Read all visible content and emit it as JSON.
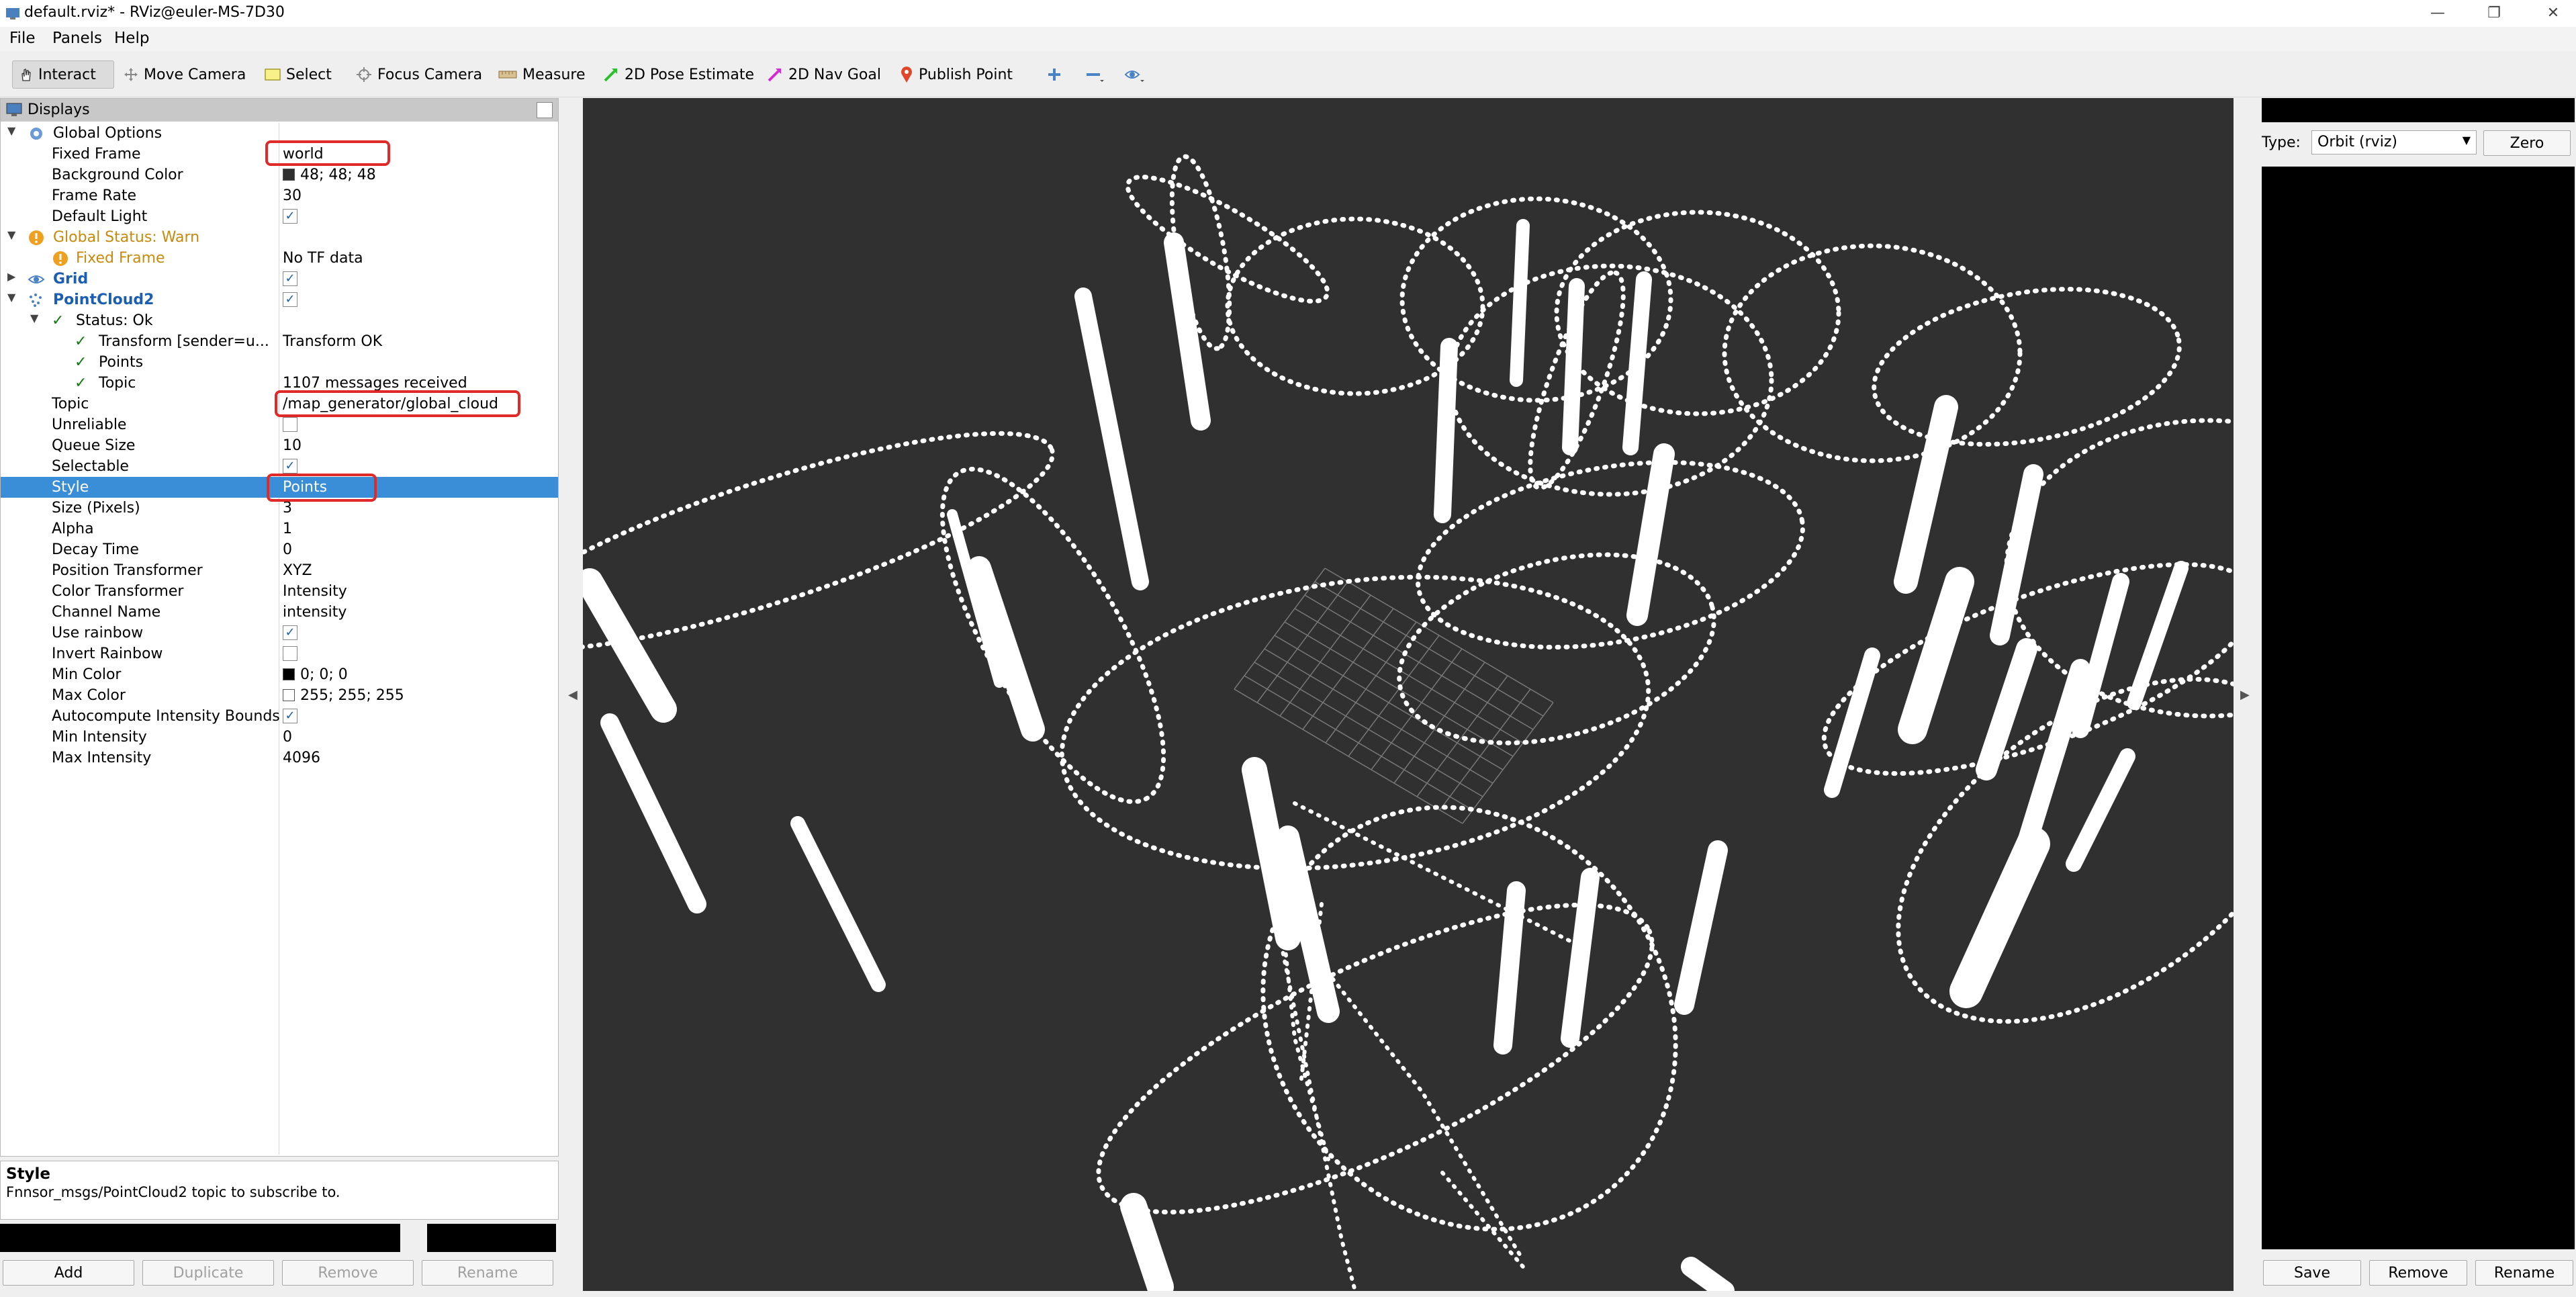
{
  "window": {
    "title": "default.rviz* - RViz@euler-MS-7D30",
    "controls": [
      "—",
      "❐",
      "✕"
    ]
  },
  "menu": [
    "File",
    "Panels",
    "Help"
  ],
  "toolbar": {
    "interact": "Interact",
    "move_camera": "Move Camera",
    "select": "Select",
    "focus_camera": "Focus Camera",
    "measure": "Measure",
    "pose_estimate": "2D Pose Estimate",
    "nav_goal": "2D Nav Goal",
    "publish_point": "Publish Point"
  },
  "displays": {
    "title": "Displays",
    "global_options": "Global Options",
    "fixed_frame_label": "Fixed Frame",
    "fixed_frame_value": "world",
    "background_color_label": "Background Color",
    "background_color_value": "48; 48; 48",
    "frame_rate_label": "Frame Rate",
    "frame_rate_value": "30",
    "default_light_label": "Default Light",
    "default_light_checked": "✓",
    "global_status": "Global Status: Warn",
    "status_fixed_frame": "Fixed Frame",
    "status_fixed_frame_value": "No TF data",
    "grid": "Grid",
    "grid_checked": "✓",
    "pointcloud2": "PointCloud2",
    "pointcloud2_checked": "✓",
    "status_ok": "Status: Ok",
    "transform_label": "Transform [sender=u...",
    "transform_value": "Transform OK",
    "points_label": "Points",
    "topic_status_label": "Topic",
    "topic_status_value": "1107 messages received",
    "topic_label": "Topic",
    "topic_value": "/map_generator/global_cloud",
    "unreliable_label": "Unreliable",
    "queue_size_label": "Queue Size",
    "queue_size_value": "10",
    "selectable_label": "Selectable",
    "selectable_checked": "✓",
    "style_label": "Style",
    "style_value": "Points",
    "size_label": "Size (Pixels)",
    "size_value": "3",
    "alpha_label": "Alpha",
    "alpha_value": "1",
    "decay_label": "Decay Time",
    "decay_value": "0",
    "pos_transformer_label": "Position Transformer",
    "pos_transformer_value": "XYZ",
    "color_transformer_label": "Color Transformer",
    "color_transformer_value": "Intensity",
    "channel_label": "Channel Name",
    "channel_value": "intensity",
    "use_rainbow_label": "Use rainbow",
    "use_rainbow_checked": "✓",
    "invert_rainbow_label": "Invert Rainbow",
    "min_color_label": "Min Color",
    "min_color_value": "0; 0; 0",
    "max_color_label": "Max Color",
    "max_color_value": "255; 255; 255",
    "autocompute_label": "Autocompute Intensity Bounds",
    "autocompute_checked": "✓",
    "min_intensity_label": "Min Intensity",
    "min_intensity_value": "0",
    "max_intensity_label": "Max Intensity",
    "max_intensity_value": "4096"
  },
  "description": {
    "title": "Style",
    "text": "Fnnsor_msgs/PointCloud2 topic to subscribe to."
  },
  "display_buttons": {
    "add": "Add",
    "duplicate": "Duplicate",
    "remove": "Remove",
    "rename": "Rename"
  },
  "views": {
    "type_label": "Type:",
    "type_value": "Orbit (rviz)",
    "zero": "Zero",
    "save": "Save",
    "remove": "Remove",
    "rename": "Rename"
  },
  "colors": {
    "viewport_bg": "#303030",
    "selection": "#3a8ed8",
    "highlight": "#e02a2a"
  }
}
